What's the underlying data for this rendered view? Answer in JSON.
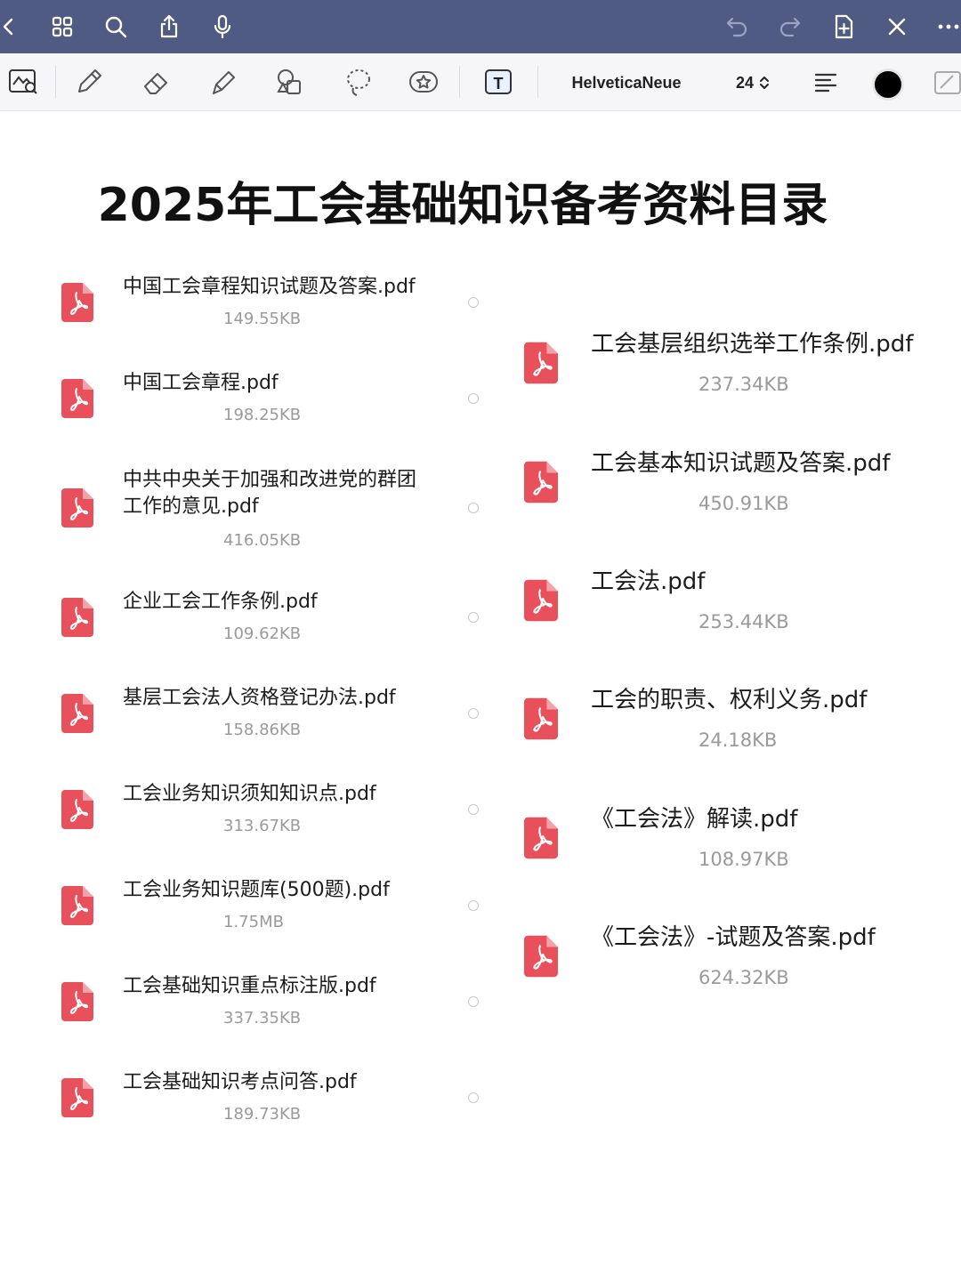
{
  "topbar": {
    "icons": [
      "back-icon",
      "grid-icon",
      "search-icon",
      "share-icon",
      "microphone-icon",
      "undo-icon",
      "redo-icon",
      "add-page-icon",
      "close-icon",
      "more-icon"
    ]
  },
  "toolbar": {
    "tools": [
      "image-select-icon",
      "pen-icon",
      "eraser-icon",
      "highlighter-icon",
      "shapes-icon",
      "lasso-icon",
      "sticker-icon",
      "text-tool-icon"
    ],
    "font_name": "HelveticaNeue",
    "font_size": "24",
    "color": "#000000"
  },
  "title": "2025年工会基础知识备考资料目录",
  "files_left": [
    {
      "name": "中国工会章程知识试题及答案.pdf",
      "size": "149.55KB"
    },
    {
      "name": "中国工会章程.pdf",
      "size": "198.25KB"
    },
    {
      "name": "中共中央关于加强和改进党的群团工作的意见.pdf",
      "size": "416.05KB"
    },
    {
      "name": "企业工会工作条例.pdf",
      "size": "109.62KB"
    },
    {
      "name": "基层工会法人资格登记办法.pdf",
      "size": "158.86KB"
    },
    {
      "name": "工会业务知识须知知识点.pdf",
      "size": "313.67KB"
    },
    {
      "name": "工会业务知识题库(500题).pdf",
      "size": "1.75MB"
    },
    {
      "name": "工会基础知识重点标注版.pdf",
      "size": "337.35KB"
    },
    {
      "name": "工会基础知识考点问答.pdf",
      "size": "189.73KB"
    }
  ],
  "files_right": [
    {
      "name": "工会基层组织选举工作条例.pdf",
      "size": "237.34KB"
    },
    {
      "name": "工会基本知识试题及答案.pdf",
      "size": "450.91KB"
    },
    {
      "name": "工会法.pdf",
      "size": "253.44KB"
    },
    {
      "name": "工会的职责、权利义务.pdf",
      "size": "24.18KB"
    },
    {
      "name": "《工会法》解读.pdf",
      "size": "108.97KB"
    },
    {
      "name": "《工会法》-试题及答案.pdf",
      "size": "624.32KB"
    }
  ],
  "colors": {
    "topbar": "#4f5b82",
    "pdf_icon": "#e8505b"
  }
}
